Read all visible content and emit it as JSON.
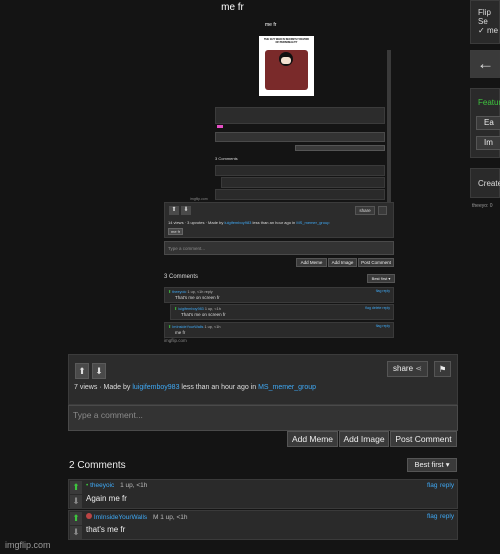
{
  "page": {
    "title": "me fr",
    "footer": "imgflip.com"
  },
  "sidebar": {
    "flip_label": "Flip Se",
    "me_check": "me",
    "featured_label": "Featur",
    "btn1": "Ea",
    "btn2": "Im",
    "create_label": "Create",
    "user_tag": "theeyo: 0"
  },
  "post": {
    "stats": "7 views · Made by",
    "author": "luigifemboy983",
    "time": " less than an hour ago in ",
    "stream": "MS_memer_group",
    "share": "share",
    "comment_placeholder": "Type a comment...",
    "add_meme": "Add Meme",
    "add_image": "Add Image",
    "post_comment": "Post Comment"
  },
  "comments": {
    "count": "2 Comments",
    "sort": "Best first",
    "items": [
      {
        "user": "theeyoic",
        "meta": "1 up, <1h",
        "text": "Again me fr",
        "flag": "flag",
        "reply": "reply"
      },
      {
        "user": "ImInsideYourWalls",
        "meta": "M  1 up, <1h",
        "text": "that's me fr",
        "flag": "flag",
        "reply": "reply"
      }
    ]
  },
  "nested1": {
    "stats": "14 views · 3 upvotes · Made by",
    "author": "luigifemboy983",
    "time": " less than an hour ago in ",
    "stream": "MS_memer_group",
    "share": "share",
    "tag": "me fr",
    "placeholder": "Type a comment...",
    "add_meme": "Add Meme",
    "add_image": "Add Image",
    "post_comment": "Post Comment",
    "count": "3 Comments",
    "sort": "Best first",
    "items": [
      {
        "user": "theeyoic",
        "meta": "1 up, <1h reply",
        "text": "That's me on screen fr",
        "right": "flag reply"
      },
      {
        "user": "luigifemboy983",
        "meta": "1 up, <1h",
        "text": "That's me on screen fr",
        "right": "flag delete reply"
      },
      {
        "user": "ImInsideYourWalls",
        "meta": "1 up, <1h",
        "text": "me fr",
        "right": "flag reply"
      }
    ],
    "footer": "imgflip.com"
  },
  "nested2": {
    "title": "me fr",
    "count": "3 Comments",
    "footer": "imgflip.com",
    "meme_caption": "THE GUY WHO IS SECRETLY DEVOID OF PERSONALITY"
  }
}
